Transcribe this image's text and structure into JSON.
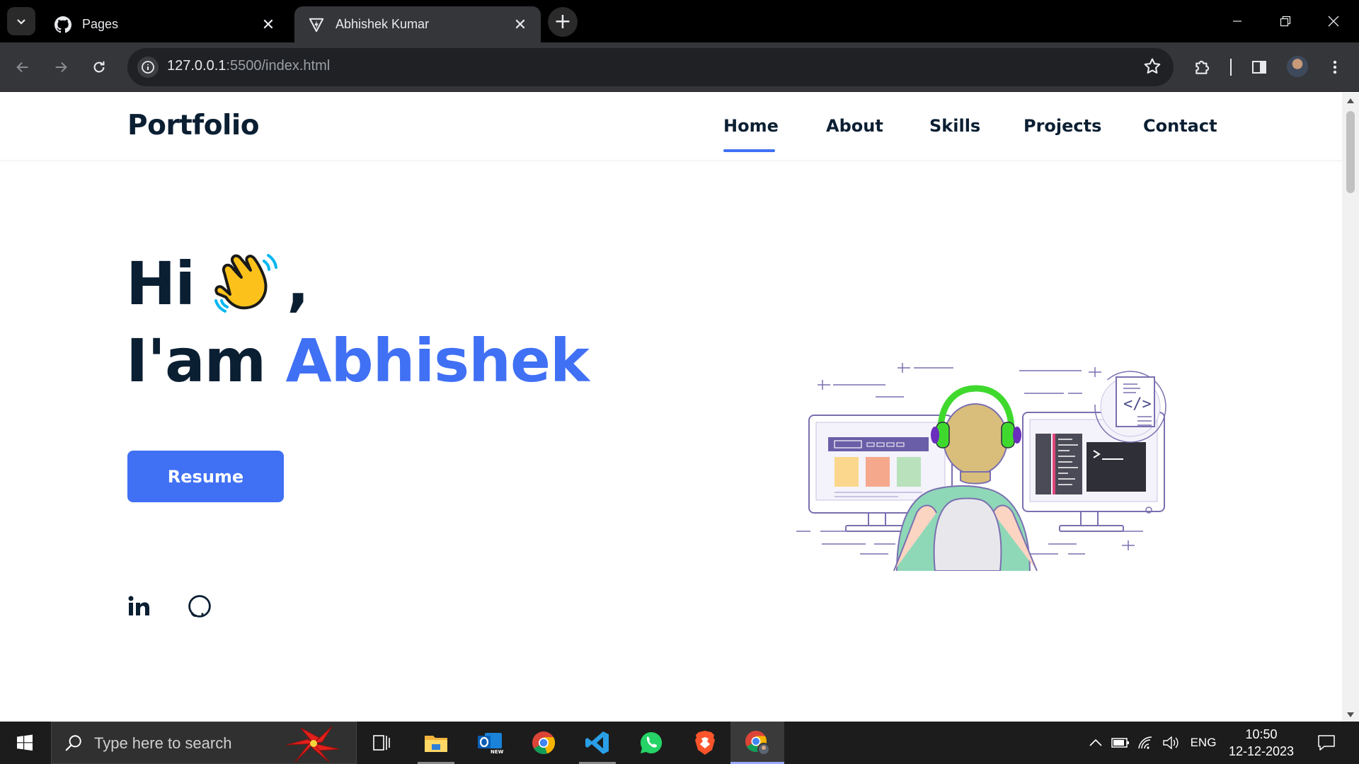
{
  "browser": {
    "tabs": [
      {
        "title": "Pages",
        "favicon": "github-icon",
        "active": false
      },
      {
        "title": "Abhishek Kumar",
        "favicon": "vite-icon",
        "active": true
      }
    ],
    "url_host": "127.0.0.1",
    "url_path": ":5500/index.html"
  },
  "site": {
    "logo": "Portfolio",
    "nav": [
      "Home",
      "About",
      "Skills",
      "Projects",
      "Contact"
    ],
    "active_nav": "Home",
    "hero": {
      "greeting": "Hi",
      "greeting_suffix": ",",
      "intro": "I'am ",
      "name": "Abhishek",
      "resume_label": "Resume"
    },
    "social": [
      "linkedin-icon",
      "github-icon"
    ],
    "accent_color": "#4070f4",
    "text_color": "#0b1f33"
  },
  "taskbar": {
    "search_placeholder": "Type here to search",
    "apps": [
      "task-view-icon",
      "file-explorer-icon",
      "outlook-icon",
      "chrome-icon",
      "vscode-icon",
      "whatsapp-icon",
      "brave-icon",
      "chrome-profile-icon"
    ],
    "language": "ENG",
    "time": "10:50",
    "date": "12-12-2023"
  }
}
